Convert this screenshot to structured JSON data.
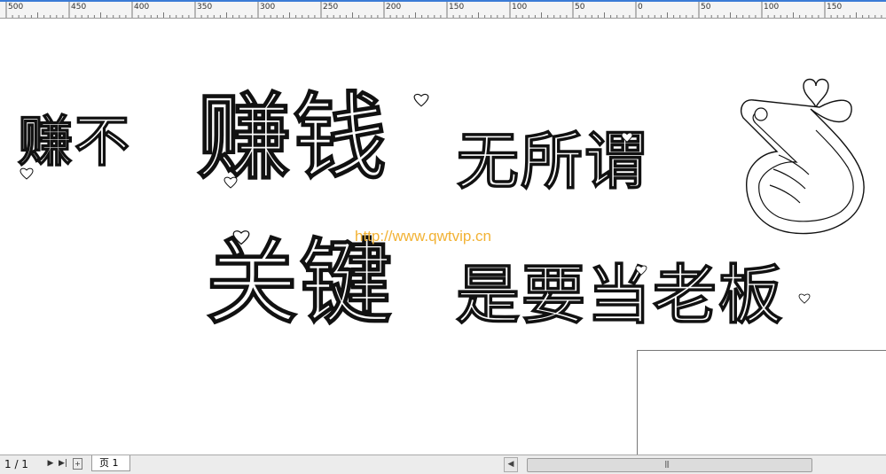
{
  "ruler": {
    "labels": [
      "500",
      "450",
      "400",
      "350",
      "300",
      "250",
      "200",
      "150",
      "100",
      "50",
      "0",
      "50",
      "100",
      "150"
    ]
  },
  "canvas": {
    "lines": [
      {
        "id": "line1a",
        "text": "赚不"
      },
      {
        "id": "line1b",
        "text": "赚钱"
      },
      {
        "id": "line1c",
        "text": "无所谓"
      },
      {
        "id": "line2a",
        "text": "关键"
      },
      {
        "id": "line2b",
        "text": "是要当老板"
      }
    ],
    "watermark": "http://www.qwtvip.cn",
    "icons": [
      "finger-heart-icon",
      "heart-icon"
    ]
  },
  "statusbar": {
    "page_counter": "1 / 1",
    "page_tab": "页 1"
  }
}
